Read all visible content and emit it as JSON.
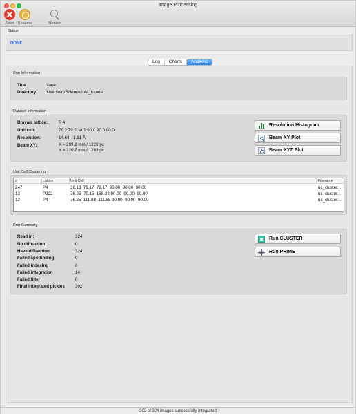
{
  "window": {
    "title": "Image Processing"
  },
  "toolbar": {
    "abort": {
      "label": "Abort",
      "icon": "abort-icon"
    },
    "resume": {
      "label": "Resume",
      "icon": "resume-icon"
    },
    "monitor": {
      "label": "Monitor",
      "icon": "magnifier-icon"
    }
  },
  "status": {
    "section_label": "Status",
    "value": "DONE",
    "value_color": "#1f5fd6"
  },
  "tabs": [
    {
      "label": "Log",
      "active": false
    },
    {
      "label": "Charts",
      "active": false
    },
    {
      "label": "Analysis",
      "active": true
    }
  ],
  "run_info": {
    "section_label": "Run Information",
    "title_key": "Title",
    "title_value": "None",
    "directory_key": "Directory",
    "directory_value": "/Users/art/Science/iota_tutorial"
  },
  "dataset_info": {
    "section_label": "Dataset Information",
    "bravais_key": "Bravais lattice:",
    "bravais_value": "P 4",
    "unit_cell_key": "Unit cell:",
    "unit_cell_value": "79.2 79.2 38.1 90.0 90.0 90.0",
    "resolution_key": "Resolution:",
    "resolution_value": "14.64 - 1.61 Å",
    "beam_key": "Beam XY:",
    "beam_x": "X = 209.9 mm / 1220 px",
    "beam_y": "Y = 220.7 mm / 1283 px",
    "buttons": {
      "resolution_histogram": "Resolution Histogram",
      "beam_xy_plot": "Beam XY Plot",
      "beam_xyz_plot": "Beam XYZ Plot"
    }
  },
  "unit_cell_clustering": {
    "section_label": "Unit Cell Clustering",
    "columns": [
      "#",
      "Lattice",
      "Unit Cell",
      "Filename"
    ],
    "rows": [
      {
        "count": "247",
        "lattice": "P4",
        "cell": "38.13  79.17  79.17  90.00  90.00  90.00",
        "file": "uc_cluster..."
      },
      {
        "count": "13",
        "lattice": "P222",
        "cell": "76.25  79.15  158.32 90.00  90.00  90.00",
        "file": "uc_cluster..."
      },
      {
        "count": "12",
        "lattice": "P4",
        "cell": "76.25  111.88  111.88 90.00  90.00  90.00",
        "file": "uc_cluster..."
      }
    ]
  },
  "run_summary": {
    "section_label": "Run Summary",
    "items": [
      {
        "key": "Read in:",
        "value": "324"
      },
      {
        "key": "No diffraction:",
        "value": "0"
      },
      {
        "key": "Have diffraction:",
        "value": "324"
      },
      {
        "key": "Failed spotfinding",
        "value": "0"
      },
      {
        "key": "Failed indexing",
        "value": "8"
      },
      {
        "key": "Failed integration",
        "value": "14"
      },
      {
        "key": "Failed filter",
        "value": "0"
      },
      {
        "key": "Final integrated pickles",
        "value": "302"
      }
    ],
    "buttons": {
      "run_cluster": "Run CLUSTER",
      "run_prime": "Run PRIME"
    }
  },
  "statusbar": {
    "text": "302 of 324 images successfully integrated"
  }
}
